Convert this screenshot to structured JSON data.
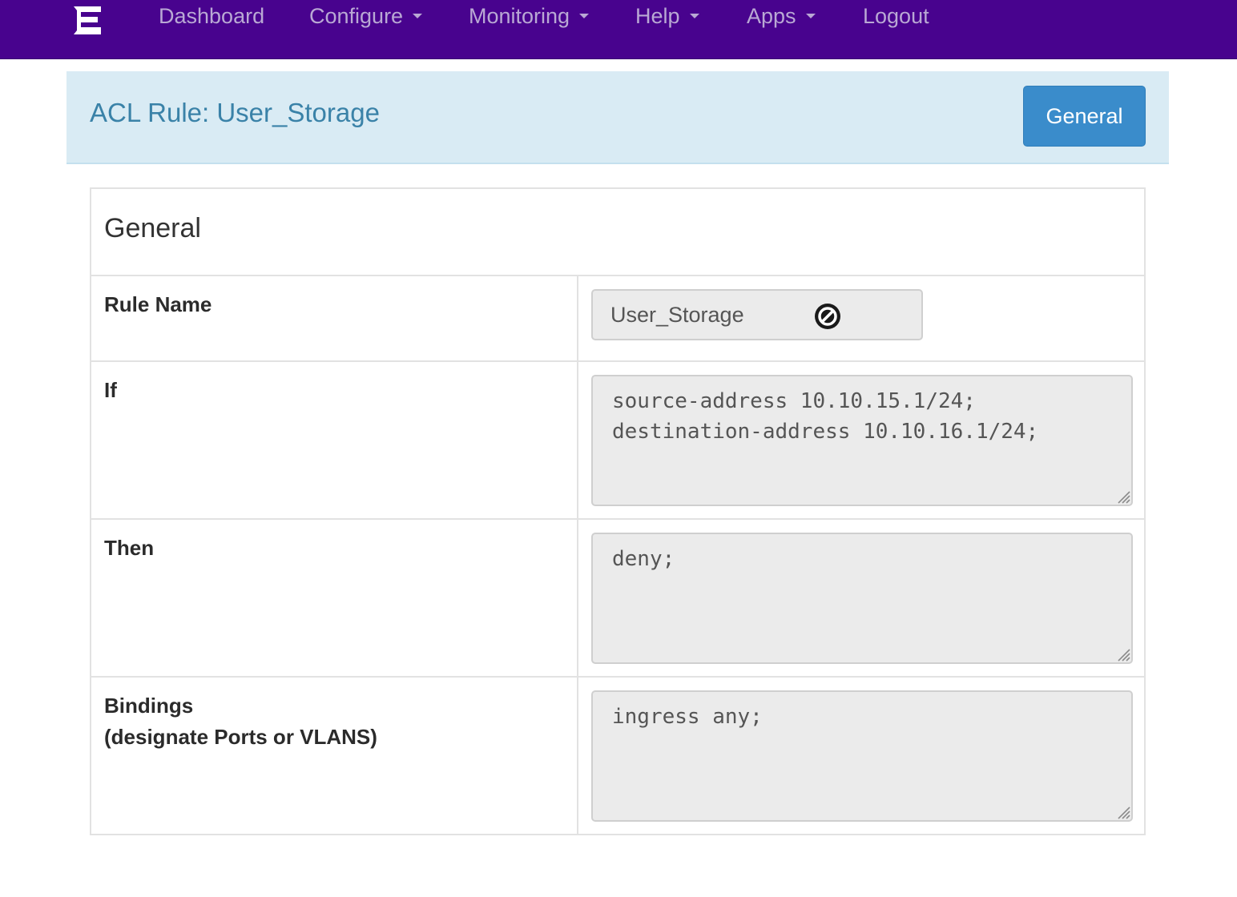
{
  "nav": {
    "logo_icon": "extreme-networks-logo-icon",
    "items": [
      {
        "label": "Dashboard",
        "dropdown": false
      },
      {
        "label": "Configure",
        "dropdown": true
      },
      {
        "label": "Monitoring",
        "dropdown": true
      },
      {
        "label": "Help",
        "dropdown": true
      },
      {
        "label": "Apps",
        "dropdown": true
      },
      {
        "label": "Logout",
        "dropdown": false
      }
    ]
  },
  "header": {
    "title": "ACL Rule: User_Storage",
    "button_label": "General"
  },
  "form": {
    "section_title": "General",
    "rule_name": {
      "label": "Rule Name",
      "value": "User_Storage",
      "icon": "no-entry-icon"
    },
    "if": {
      "label": "If",
      "value": "source-address 10.10.15.1/24;\ndestination-address 10.10.16.1/24;"
    },
    "then": {
      "label": "Then",
      "value": "deny;"
    },
    "bindings": {
      "label_line1": "Bindings",
      "label_line2": "(designate Ports or VLANS)",
      "value": "ingress any;"
    }
  },
  "colors": {
    "navbar": "#48038e",
    "nav_text": "#b9a8d4",
    "header_bg": "#d9ebf4",
    "title_text": "#3a82a8",
    "button_bg": "#3a8ccb"
  }
}
